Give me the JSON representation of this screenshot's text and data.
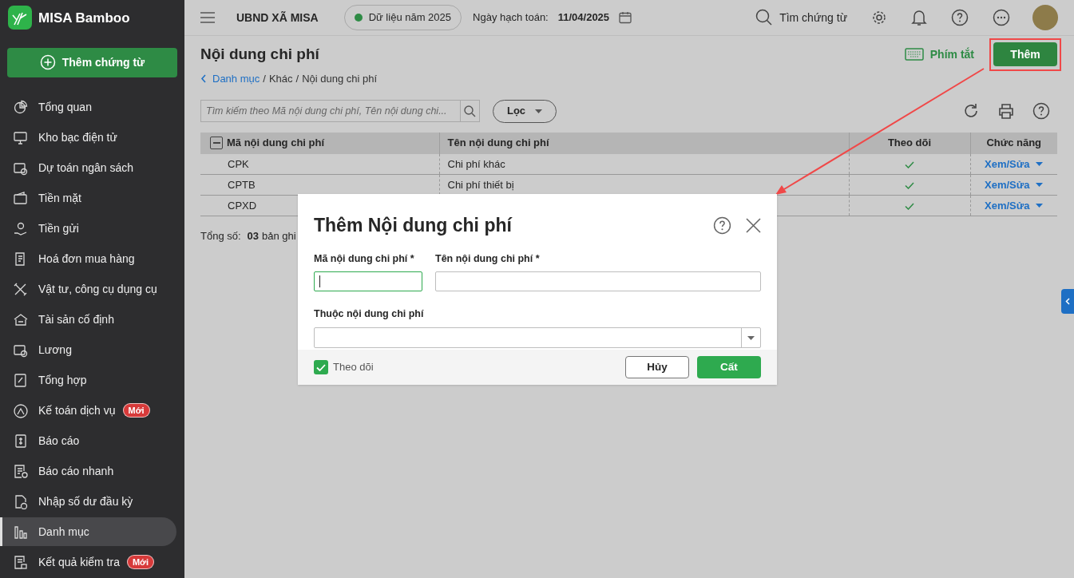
{
  "sidebar": {
    "brand": "MISA Bamboo",
    "add_button": "Thêm chứng từ",
    "items": [
      {
        "label": "Tổng quan",
        "selected": false
      },
      {
        "label": "Kho bạc điện tử",
        "selected": false
      },
      {
        "label": "Dự toán ngân sách",
        "selected": false
      },
      {
        "label": "Tiền mặt",
        "selected": false
      },
      {
        "label": "Tiền gửi",
        "selected": false
      },
      {
        "label": "Hoá đơn mua hàng",
        "selected": false
      },
      {
        "label": "Vật tư, công cụ dụng cụ",
        "selected": false
      },
      {
        "label": "Tài sản cố định",
        "selected": false
      },
      {
        "label": "Lương",
        "selected": false
      },
      {
        "label": "Tổng hợp",
        "selected": false
      },
      {
        "label": "Kế toán dịch vụ",
        "selected": false,
        "badge": "Mới"
      },
      {
        "label": "Báo cáo",
        "selected": false
      },
      {
        "label": "Báo cáo nhanh",
        "selected": false
      },
      {
        "label": "Nhập số dư đầu kỳ",
        "selected": false
      },
      {
        "label": "Danh mục",
        "selected": true
      },
      {
        "label": "Kết quả kiểm tra",
        "selected": false,
        "badge": "Mới"
      }
    ]
  },
  "topbar": {
    "org": "UBND XÃ MISA",
    "data_year": {
      "label": "Dữ liệu năm 2025",
      "color": "#2e8b45"
    },
    "posting_date": {
      "label": "Ngày hạch toán:",
      "value": "11/04/2025"
    },
    "search": "Tìm chứng từ"
  },
  "page": {
    "title": "Nội dung chi phí",
    "breadcrumb": [
      {
        "label": "Danh mục",
        "kind": "link"
      },
      {
        "label": "/",
        "kind": "separator"
      },
      {
        "label": "Khác",
        "kind": "text"
      },
      {
        "label": "/",
        "kind": "separator"
      },
      {
        "label": "Nội dung chi phí",
        "kind": "text"
      }
    ],
    "shortcut": "Phím tắt",
    "add_button": "Thêm"
  },
  "toolbar": {
    "search_placeholder": "Tìm kiếm theo Mã nội dung chi phí, Tên nội dung chi...",
    "filter": "Lọc"
  },
  "table": {
    "select_all_partial": true,
    "columns": [
      "Mã nội dung chi phí",
      "Tên nội dung chi phí",
      "Theo dõi",
      "Chức năng"
    ],
    "rows": [
      {
        "code": "CPK",
        "name": "Chi phí khác",
        "followed": true,
        "action": "Xem/Sửa"
      },
      {
        "code": "CPTB",
        "name": "Chi phí thiết bị",
        "followed": true,
        "action": "Xem/Sửa"
      },
      {
        "code": "CPXD",
        "followed": true,
        "action": "Xem/Sửa"
      }
    ]
  },
  "total": {
    "label": "Tổng số:",
    "count": "03",
    "unit": "bản ghi"
  },
  "dialog": {
    "title": "Thêm Nội dung chi phí",
    "fields": [
      {
        "label": "Mã nội dung chi phí *",
        "kind": "text",
        "focused": true
      },
      {
        "label": "Tên nội dung chi phí *",
        "kind": "text",
        "focused": false
      },
      {
        "label": "Thuộc nội dung chi phí",
        "kind": "select",
        "focused": false
      }
    ],
    "follow": {
      "label": "Theo dõi",
      "checked": true
    },
    "cancel": "Hủy",
    "save": "Cất"
  }
}
